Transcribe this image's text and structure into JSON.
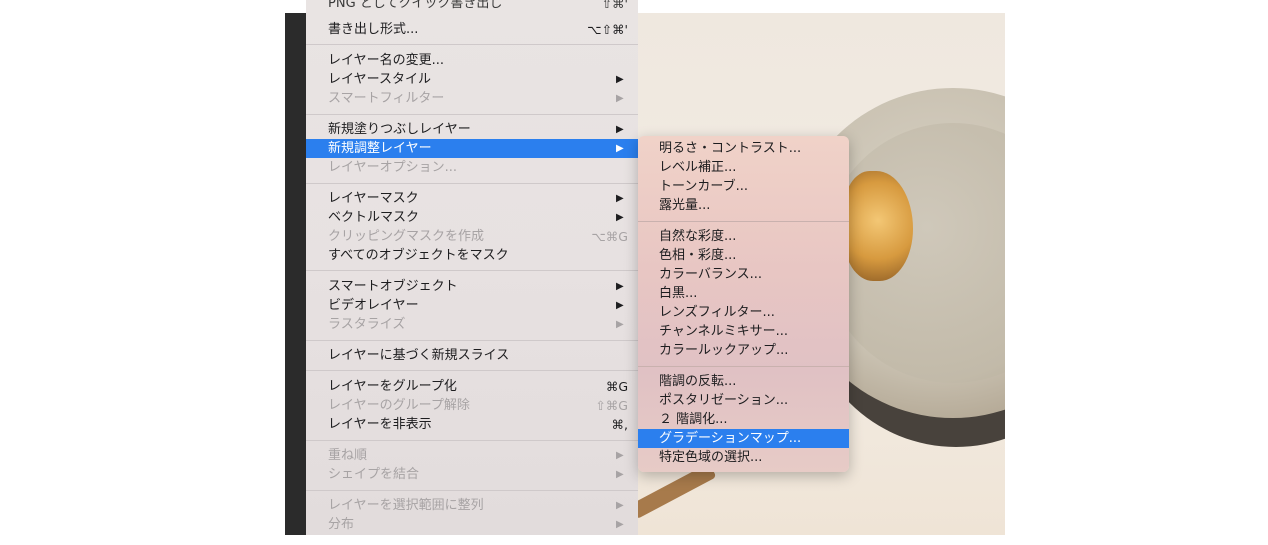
{
  "main_menu": {
    "items": [
      {
        "label": "PNG としてクイック書き出し",
        "shortcut": "⇧⌘'",
        "arrow": "",
        "state": "partial"
      },
      {
        "label": "書き出し形式...",
        "shortcut": "⌥⇧⌘'",
        "arrow": "",
        "state": "enabled"
      },
      {
        "label": "レイヤー名の変更...",
        "shortcut": "",
        "arrow": "",
        "state": "enabled"
      },
      {
        "label": "レイヤースタイル",
        "shortcut": "",
        "arrow": "▶",
        "state": "enabled"
      },
      {
        "label": "スマートフィルター",
        "shortcut": "",
        "arrow": "▶",
        "state": "disabled"
      },
      {
        "label": "新規塗りつぶしレイヤー",
        "shortcut": "",
        "arrow": "▶",
        "state": "enabled"
      },
      {
        "label": "新規調整レイヤー",
        "shortcut": "",
        "arrow": "▶",
        "state": "selected"
      },
      {
        "label": "レイヤーオプション...",
        "shortcut": "",
        "arrow": "",
        "state": "disabled"
      },
      {
        "label": "レイヤーマスク",
        "shortcut": "",
        "arrow": "▶",
        "state": "enabled"
      },
      {
        "label": "ベクトルマスク",
        "shortcut": "",
        "arrow": "▶",
        "state": "enabled"
      },
      {
        "label": "クリッピングマスクを作成",
        "shortcut": "⌥⌘G",
        "arrow": "",
        "state": "disabled"
      },
      {
        "label": "すべてのオブジェクトをマスク",
        "shortcut": "",
        "arrow": "",
        "state": "enabled"
      },
      {
        "label": "スマートオブジェクト",
        "shortcut": "",
        "arrow": "▶",
        "state": "enabled"
      },
      {
        "label": "ビデオレイヤー",
        "shortcut": "",
        "arrow": "▶",
        "state": "enabled"
      },
      {
        "label": "ラスタライズ",
        "shortcut": "",
        "arrow": "▶",
        "state": "disabled"
      },
      {
        "label": "レイヤーに基づく新規スライス",
        "shortcut": "",
        "arrow": "",
        "state": "enabled"
      },
      {
        "label": "レイヤーをグループ化",
        "shortcut": "⌘G",
        "arrow": "",
        "state": "enabled"
      },
      {
        "label": "レイヤーのグループ解除",
        "shortcut": "⇧⌘G",
        "arrow": "",
        "state": "disabled"
      },
      {
        "label": "レイヤーを非表示",
        "shortcut": "⌘,",
        "arrow": "",
        "state": "enabled"
      },
      {
        "label": "重ね順",
        "shortcut": "",
        "arrow": "▶",
        "state": "disabled"
      },
      {
        "label": "シェイプを結合",
        "shortcut": "",
        "arrow": "▶",
        "state": "disabled"
      },
      {
        "label": "レイヤーを選択範囲に整列",
        "shortcut": "",
        "arrow": "▶",
        "state": "disabled"
      },
      {
        "label": "分布",
        "shortcut": "",
        "arrow": "▶",
        "state": "disabled"
      }
    ]
  },
  "submenu": {
    "items": [
      {
        "label": "明るさ・コントラスト...",
        "state": "enabled"
      },
      {
        "label": "レベル補正...",
        "state": "enabled"
      },
      {
        "label": "トーンカーブ...",
        "state": "enabled"
      },
      {
        "label": "露光量...",
        "state": "enabled"
      },
      {
        "label": "自然な彩度...",
        "state": "enabled"
      },
      {
        "label": "色相・彩度...",
        "state": "enabled"
      },
      {
        "label": "カラーバランス...",
        "state": "enabled"
      },
      {
        "label": "白黒...",
        "state": "enabled"
      },
      {
        "label": "レンズフィルター...",
        "state": "enabled"
      },
      {
        "label": "チャンネルミキサー...",
        "state": "enabled"
      },
      {
        "label": "カラールックアップ...",
        "state": "enabled"
      },
      {
        "label": "階調の反転...",
        "state": "enabled"
      },
      {
        "label": "ポスタリゼーション...",
        "state": "enabled"
      },
      {
        "label": "２ 階調化...",
        "state": "enabled"
      },
      {
        "label": "グラデーションマップ...",
        "state": "selected"
      },
      {
        "label": "特定色域の選択...",
        "state": "enabled"
      }
    ]
  },
  "colors": {
    "selection": "#2b7fee",
    "disabled_text": "#a7a3a4",
    "menu_background": "#e9e4e3",
    "submenu_background": "#e8c6c3"
  }
}
